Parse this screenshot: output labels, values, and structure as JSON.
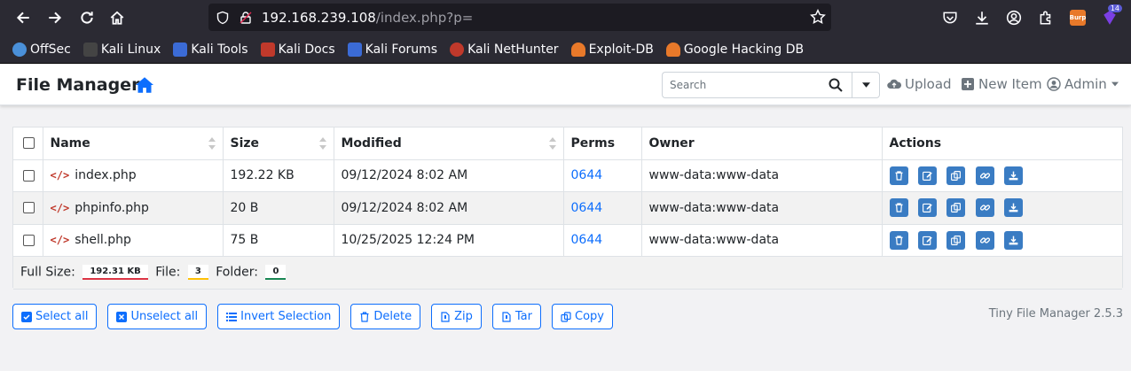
{
  "browser": {
    "url_host": "192.168.239.108",
    "url_path": "/index.php?p=",
    "extension_badge": "14",
    "burp_label": "Burp",
    "bookmarks": [
      {
        "label": "OffSec",
        "color": "#4a90d9"
      },
      {
        "label": "Kali Linux",
        "color": "#333333"
      },
      {
        "label": "Kali Tools",
        "color": "#3b6bd6"
      },
      {
        "label": "Kali Docs",
        "color": "#c0392b"
      },
      {
        "label": "Kali Forums",
        "color": "#3b6bd6"
      },
      {
        "label": "Kali NetHunter",
        "color": "#c0392b"
      },
      {
        "label": "Exploit-DB",
        "color": "#e8792a"
      },
      {
        "label": "Google Hacking DB",
        "color": "#e8792a"
      }
    ]
  },
  "header": {
    "brand": "File Manager",
    "search_placeholder": "Search",
    "upload_label": "Upload",
    "new_item_label": "New Item",
    "admin_label": "Admin"
  },
  "table": {
    "columns": [
      "Name",
      "Size",
      "Modified",
      "Perms",
      "Owner",
      "Actions"
    ],
    "rows": [
      {
        "name": "index.php",
        "size": "192.22 KB",
        "modified": "09/12/2024 8:02 AM",
        "perms": "0644",
        "owner": "www-data:www-data"
      },
      {
        "name": "phpinfo.php",
        "size": "20 B",
        "modified": "09/12/2024 8:02 AM",
        "perms": "0644",
        "owner": "www-data:www-data"
      },
      {
        "name": "shell.php",
        "size": "75 B",
        "modified": "10/25/2025 12:24 PM",
        "perms": "0644",
        "owner": "www-data:www-data"
      }
    ],
    "footer": {
      "full_size_label": "Full Size:",
      "full_size_value": "192.31 KB",
      "file_label": "File:",
      "file_value": "3",
      "folder_label": "Folder:",
      "folder_value": "0"
    }
  },
  "buttons": {
    "select_all": "Select all",
    "unselect_all": "Unselect all",
    "invert_selection": "Invert Selection",
    "delete": "Delete",
    "zip": "Zip",
    "tar": "Tar",
    "copy": "Copy"
  },
  "version": "Tiny File Manager 2.5.3",
  "colors": {
    "accent": "#0d6efd",
    "action_button": "#3a7cc3",
    "full_size_underline": "#dc3545",
    "file_underline": "#ffc107",
    "folder_underline": "#198754"
  }
}
